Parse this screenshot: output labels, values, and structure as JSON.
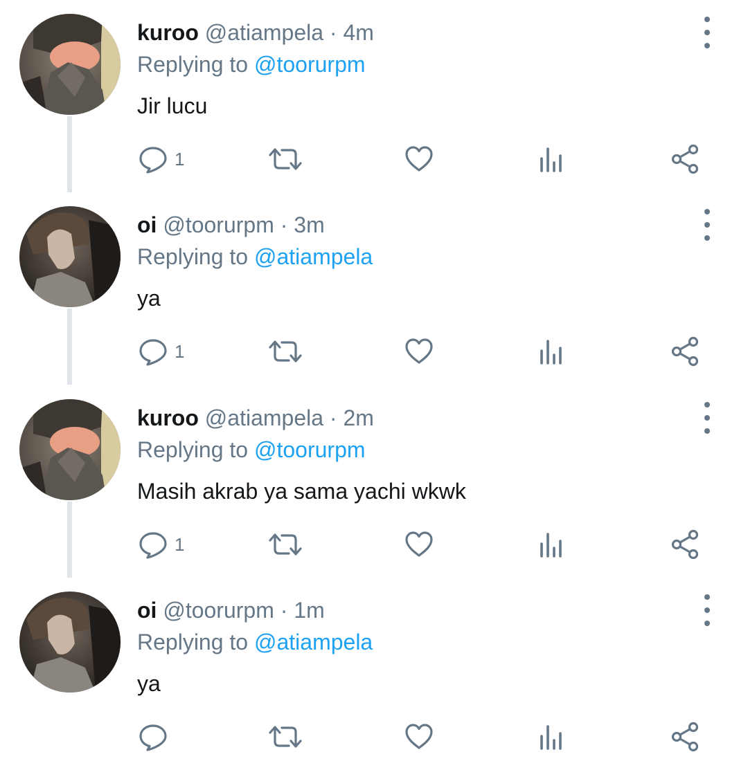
{
  "tweets": [
    {
      "name": "kuroo",
      "handle": "@atiampela",
      "sep": "·",
      "time": "4m",
      "replying_prefix": "Replying to ",
      "replying_to": "@toorurpm",
      "text": "Jir lucu",
      "reply_count": "1",
      "avatar": "cat-avatar"
    },
    {
      "name": "oi",
      "handle": "@toorurpm",
      "sep": "·",
      "time": "3m",
      "replying_prefix": "Replying to ",
      "replying_to": "@atiampela",
      "text": "ya",
      "reply_count": "1",
      "avatar": "person-avatar"
    },
    {
      "name": "kuroo",
      "handle": "@atiampela",
      "sep": "·",
      "time": "2m",
      "replying_prefix": "Replying to ",
      "replying_to": "@toorurpm",
      "text": "Masih akrab ya sama yachi wkwk",
      "reply_count": "1",
      "avatar": "cat-avatar"
    },
    {
      "name": "oi",
      "handle": "@toorurpm",
      "sep": "·",
      "time": "1m",
      "replying_prefix": "Replying to ",
      "replying_to": "@atiampela",
      "text": "ya",
      "reply_count": "",
      "avatar": "person-avatar"
    }
  ],
  "icons": {
    "reply": "reply-icon",
    "retweet": "retweet-icon",
    "like": "heart-icon",
    "analytics": "analytics-icon",
    "share": "share-icon",
    "more": "more-vertical-icon"
  },
  "colors": {
    "text": "#14171a",
    "secondary": "#657786",
    "link": "#1da1f2",
    "thread_line": "#e1e4e8"
  }
}
